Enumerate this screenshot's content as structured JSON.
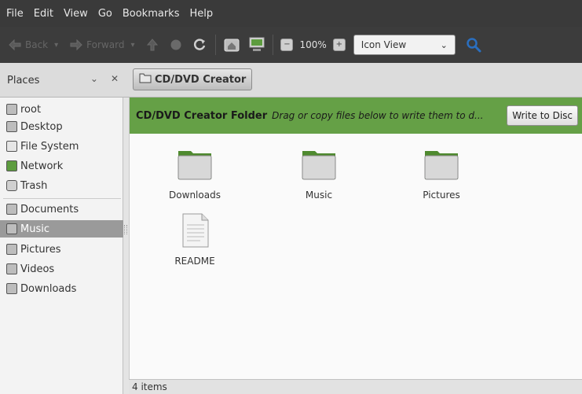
{
  "menubar": {
    "items": [
      "File",
      "Edit",
      "View",
      "Go",
      "Bookmarks",
      "Help"
    ]
  },
  "toolbar": {
    "back_label": "Back",
    "forward_label": "Forward",
    "zoom": "100%",
    "view_mode": "Icon View",
    "icons": [
      "back-arrow-icon",
      "forward-arrow-icon",
      "up-arrow-icon",
      "stop-icon",
      "reload-icon",
      "home-icon",
      "computer-icon",
      "zoom-out-icon",
      "zoom-in-icon",
      "search-icon"
    ]
  },
  "places": {
    "header": "Places",
    "items": [
      {
        "label": "root",
        "icon": "home-folder-icon"
      },
      {
        "label": "Desktop",
        "icon": "desktop-folder-icon"
      },
      {
        "label": "File System",
        "icon": "harddisk-icon"
      },
      {
        "label": "Network",
        "icon": "network-icon"
      },
      {
        "label": "Trash",
        "icon": "trash-icon"
      },
      {
        "label": "Documents",
        "icon": "documents-folder-icon"
      },
      {
        "label": "Music",
        "icon": "music-folder-icon"
      },
      {
        "label": "Pictures",
        "icon": "pictures-folder-icon"
      },
      {
        "label": "Videos",
        "icon": "videos-folder-icon"
      },
      {
        "label": "Downloads",
        "icon": "downloads-folder-icon"
      }
    ],
    "selected": "Music"
  },
  "location": {
    "path_button": "CD/DVD Creator"
  },
  "banner": {
    "title": "CD/DVD Creator Folder",
    "message": "Drag or copy files below to write them to d...",
    "button": "Write to Disc",
    "color": "#65a046"
  },
  "files": [
    {
      "name": "Downloads",
      "type": "folder"
    },
    {
      "name": "Music",
      "type": "folder"
    },
    {
      "name": "Pictures",
      "type": "folder"
    },
    {
      "name": "README",
      "type": "document"
    }
  ],
  "status": {
    "text": "4 items"
  }
}
